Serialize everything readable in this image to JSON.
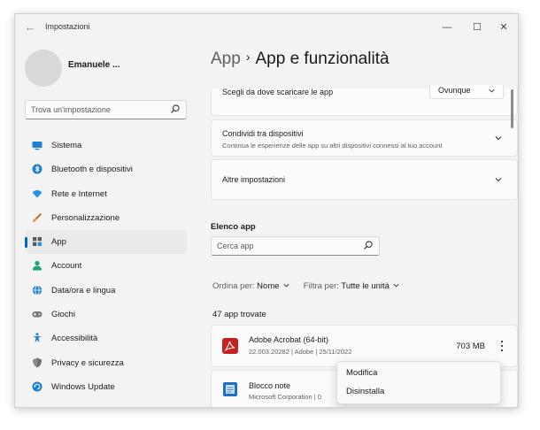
{
  "window": {
    "title": "Impostazioni",
    "controls": {
      "minimize": "—",
      "maximize": "☐",
      "close": "✕"
    }
  },
  "user": {
    "name": "Emanuele ..."
  },
  "search": {
    "placeholder": "Trova un'impostazione"
  },
  "sidebar": {
    "items": [
      {
        "label": "Sistema",
        "icon": "monitor-icon",
        "color": "#1c7fd1"
      },
      {
        "label": "Bluetooth e dispositivi",
        "icon": "bluetooth-icon",
        "color": "#1c7fd1"
      },
      {
        "label": "Rete e Internet",
        "icon": "wifi-icon",
        "color": "#2d8ee6"
      },
      {
        "label": "Personalizzazione",
        "icon": "brush-icon",
        "color": "#e0853a"
      },
      {
        "label": "App",
        "icon": "apps-icon",
        "color": "#5a5a5a",
        "active": true
      },
      {
        "label": "Account",
        "icon": "person-icon",
        "color": "#1aa37a"
      },
      {
        "label": "Data/ora e lingua",
        "icon": "globe-clock-icon",
        "color": "#1c7fd1"
      },
      {
        "label": "Giochi",
        "icon": "gamepad-icon",
        "color": "#7a7a7a"
      },
      {
        "label": "Accessibilità",
        "icon": "accessibility-icon",
        "color": "#1c7fd1"
      },
      {
        "label": "Privacy e sicurezza",
        "icon": "shield-icon",
        "color": "#8a8a8a"
      },
      {
        "label": "Windows Update",
        "icon": "update-icon",
        "color": "#1c7fd1"
      }
    ]
  },
  "breadcrumb": {
    "parent": "App",
    "separator": "›",
    "current": "App e funzionalità"
  },
  "cards": {
    "scegli": {
      "title": "Scegli da dove scaricare le app",
      "dropdown": "Ovunque"
    },
    "condividi": {
      "title": "Condividi tra dispositivi",
      "subtitle": "Continua le esperienze delle app su altri dispositivi connessi al tuo account"
    },
    "altre": {
      "title": "Altre impostazioni"
    }
  },
  "app_list": {
    "heading": "Elenco app",
    "search_placeholder": "Cerca app",
    "sort_label": "Ordina per:",
    "sort_value": "Nome",
    "filter_label": "Filtra per:",
    "filter_value": "Tutte le unità",
    "count": "47 app trovate",
    "apps": [
      {
        "name": "Adobe Acrobat (64-bit)",
        "meta": "22.003.20282  |  Adobe  |  25/11/2022",
        "size": "703 MB",
        "icon": "acrobat-icon",
        "color": "#c5221f"
      },
      {
        "name": "Blocco note",
        "meta": "Microsoft Corporation  |  0",
        "size": "",
        "icon": "notepad-icon",
        "color": "#1e6fc8"
      }
    ]
  },
  "context_menu": {
    "modify": "Modifica",
    "uninstall": "Disinstalla"
  },
  "colors": {
    "accent": "#0067c0",
    "window_bg": "#f3f3f3",
    "card_bg": "#fbfbfb"
  }
}
